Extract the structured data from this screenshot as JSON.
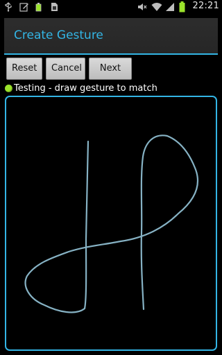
{
  "status_bar": {
    "time": "22:21",
    "left_icons": [
      "usb-icon",
      "edit-icon",
      "battery-small-icon",
      "sim-icon"
    ],
    "right_icons": [
      "mute-icon",
      "wifi-icon",
      "signal-icon",
      "battery-icon"
    ]
  },
  "dialog": {
    "title": "Create Gesture",
    "accent_color": "#33b5e5",
    "buttons": {
      "reset": "Reset",
      "cancel": "Cancel",
      "next": "Next >>"
    },
    "status": {
      "text": "Testing - draw gesture to match",
      "indicator_color": "#9be32b"
    },
    "gesture": {
      "stroke_color": "#86b2c4"
    }
  }
}
